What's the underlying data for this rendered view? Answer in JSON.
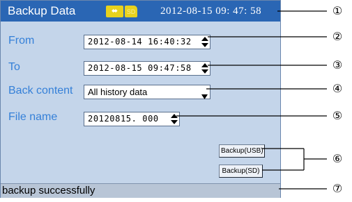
{
  "window": {
    "title": "Backup Data",
    "usb_icon": "usb-icon",
    "sd_icon_label": "SD",
    "datetime": "2012-08-15 09: 47: 58"
  },
  "form": {
    "from_label": "From",
    "from_value": "2012-08-14 16:40:32",
    "to_label": "To",
    "to_value": "2012-08-15 09:47:58",
    "content_label": "Back content",
    "content_value": "All history data",
    "filename_label": "File name",
    "filename_value": "20120815. 000"
  },
  "buttons": {
    "usb": "Backup(USB)",
    "sd": "Backup(SD)"
  },
  "status": {
    "message": "backup successfully"
  },
  "callouts": [
    "①",
    "②",
    "③",
    "④",
    "⑤",
    "⑥",
    "⑦"
  ],
  "colors": {
    "title_bar": "#2a66b4",
    "screen_bg": "#c4d5ea",
    "label_text": "#3580d8",
    "status_bar": "#b8c5d6",
    "icon_yellow": "#e8d21d"
  }
}
